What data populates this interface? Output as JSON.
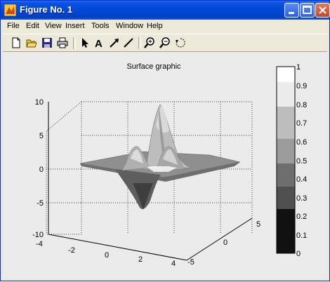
{
  "window": {
    "title": "Figure No. 1"
  },
  "menu": [
    {
      "label": "File"
    },
    {
      "label": "Edit"
    },
    {
      "label": "View"
    },
    {
      "label": "Insert"
    },
    {
      "label": "Tools"
    },
    {
      "label": "Window"
    },
    {
      "label": "Help"
    }
  ],
  "toolbar": [
    {
      "icon": "new-file-icon"
    },
    {
      "icon": "open-folder-icon"
    },
    {
      "icon": "save-icon"
    },
    {
      "icon": "print-icon"
    },
    {
      "icon": "select-arrow-icon"
    },
    {
      "icon": "insert-text-icon"
    },
    {
      "icon": "insert-arrow-icon"
    },
    {
      "icon": "insert-line-icon"
    },
    {
      "icon": "zoom-in-icon"
    },
    {
      "icon": "zoom-out-icon"
    },
    {
      "icon": "rotate-3d-icon"
    }
  ],
  "plot": {
    "title": "Surface graphic",
    "z_ticks": [
      "10",
      "5",
      "0",
      "-5",
      "-10"
    ],
    "x_ticks": [
      "-4",
      "-2",
      "0",
      "2",
      "4"
    ],
    "y_ticks": [
      "-5",
      "0",
      "5"
    ],
    "colorbar_ticks": [
      "1",
      "0.9",
      "0.8",
      "0.7",
      "0.6",
      "0.5",
      "0.4",
      "0.3",
      "0.2",
      "0.1",
      "0"
    ]
  }
}
